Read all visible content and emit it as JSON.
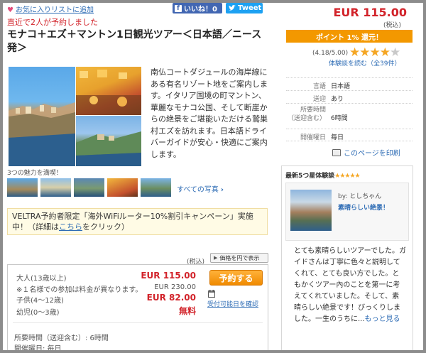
{
  "header": {
    "favorite_label": "お気に入りリストに追加",
    "fb_label": "いいね！0",
    "tweet_label": "Tweet"
  },
  "notice": "直近で2人が予約しました",
  "tour": {
    "title": "モナコ＋エズ＋マントン1日観光ツアー＜日本語／ニース発＞",
    "description": "南仏コートダジュールの海岸線にある有名リゾート地をご案内します。イタリア国境の町マントン、華麗なモナコ公国、そして断崖からの絶景をご堪能いただける鷲巣村エズを訪れます。日本語ドライバーガイドが安心・快適にご案内します。"
  },
  "gallery": {
    "caption": "3つの魅力を満喫！",
    "all_photos": "すべての写真"
  },
  "campaign": {
    "text": "VELTRA予約者限定「海外WiFiルーター10%割引キャンペーン」実施中！（詳細は",
    "link": "こちら",
    "tail": "をクリック）"
  },
  "price_strip": {
    "tax_label": "(税込)",
    "yen_button": "価格を円で表示"
  },
  "booking": {
    "adult_label": "大人(13歳以上)",
    "adult_price": "EUR 115.00",
    "single_note": "※１名様での参加は料金が異なります。",
    "single_price": "EUR 230.00",
    "child_label": "子供(4〜12歳)",
    "child_price": "EUR 82.00",
    "infant_label": "幼児(0〜3歳)",
    "infant_price": "無料",
    "reserve_button": "予約する",
    "calendar_link": "受付可能日を確認",
    "duration_line": "所要時間（送迎含む）: 6時間",
    "days_line": "開催曜日: 毎日"
  },
  "summary": {
    "price": "EUR 115.00",
    "tax_label": "(税込)",
    "points": "ポイント 1% 還元！",
    "rating_text": "(4.18/5.00)",
    "rating_value": 4.18,
    "rating_max": 5,
    "reviews_link": "体験談を読む（全39件）"
  },
  "info": [
    {
      "key": "言語",
      "value": "日本語"
    },
    {
      "key": "送迎",
      "value": "あり"
    },
    {
      "key": "所要時間 （送迎含む）",
      "value": "6時間"
    },
    {
      "key": "開催曜日",
      "value": "毎日"
    }
  ],
  "print_label": "このページを印刷",
  "review": {
    "heading": "最新5つ星体験談",
    "stars": "★★★★★",
    "by": "by: としちゃん",
    "title": "素晴らしい絶景！",
    "body": "とても素晴らしいツアーでした。ガイドさんは丁寧に色々と説明してくれて、とても良い方でした。ともかくツアー內のことを第一に考えてくれていました。そして、素晴らしい絶景です！びっくりしました。一生のうちに...",
    "more": "もっと見る"
  },
  "colors": {
    "accent_red": "#d2232a",
    "link_blue": "#2e6cb5",
    "orange": "#f39800",
    "star": "#f5a623"
  }
}
